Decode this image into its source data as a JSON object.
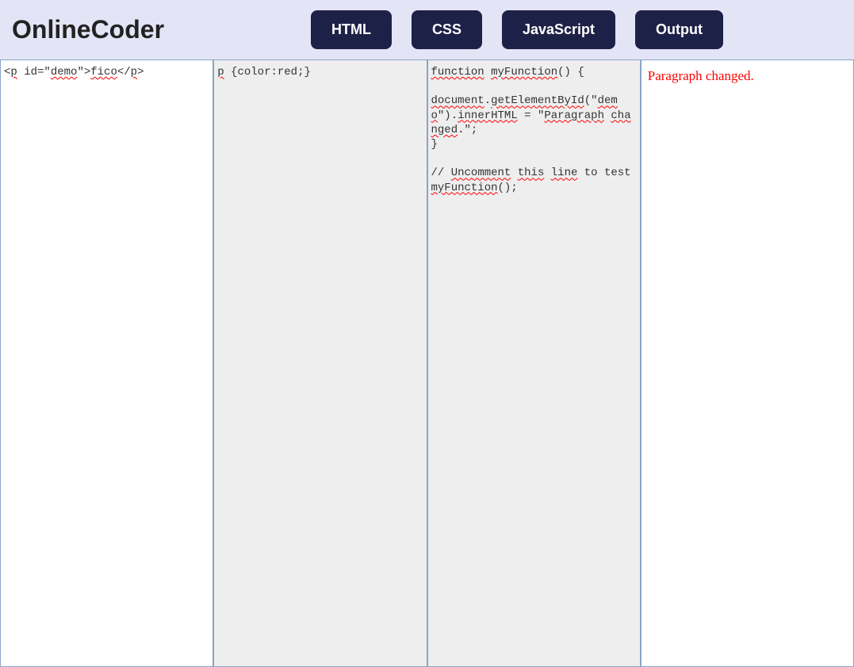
{
  "header": {
    "title": "OnlineCoder",
    "tabs": {
      "html": "HTML",
      "css": "CSS",
      "js": "JavaScript",
      "output": "Output"
    }
  },
  "panels": {
    "html_code": "<p id=\"demo\">fico</p>",
    "css_code": "p {color:red;}",
    "js_code": "function myFunction() {\n\ndocument.getElementById(\"demo\").innerHTML = \"Paragraph changed.\";\n}\n\n// Uncomment this line to test\nmyFunction();",
    "output_text": "Paragraph changed.",
    "output_color": "#ff0000"
  }
}
